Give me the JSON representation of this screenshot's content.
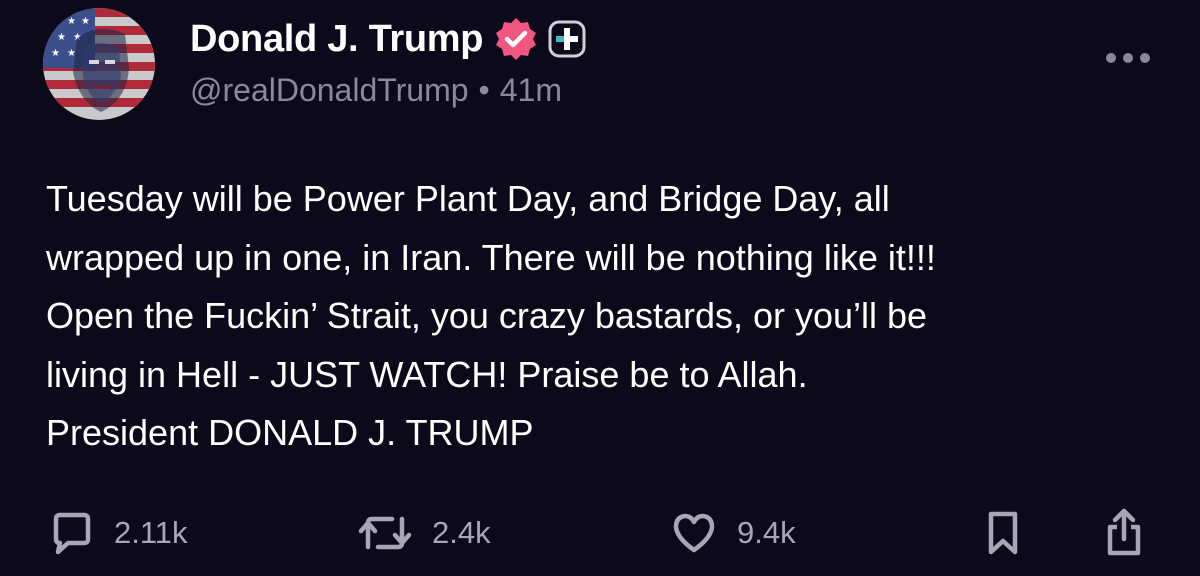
{
  "post": {
    "author": {
      "display_name": "Donald J. Trump",
      "handle": "@realDonaldTrump",
      "separator": "•",
      "time_ago": "41m",
      "avatar_icon": "flag-portrait-avatar",
      "verified_icon": "verified-badge-icon",
      "plus_icon": "plus-badge-icon"
    },
    "more_icon": "more-options-icon",
    "body_lines": [
      "Tuesday will be Power Plant Day, and Bridge Day, all",
      "wrapped up in one, in Iran. There will be nothing like it!!!",
      "Open the Fuckin’ Strait, you crazy bastards, or you’ll be",
      "living in Hell - JUST WATCH! Praise be to Allah.",
      "President DONALD J. TRUMP"
    ],
    "actions": {
      "reply": {
        "icon": "comment-icon",
        "count": "2.11k"
      },
      "repost": {
        "icon": "repost-icon",
        "count": "2.4k"
      },
      "like": {
        "icon": "heart-icon",
        "count": "9.4k"
      },
      "bookmark": {
        "icon": "bookmark-icon"
      },
      "share": {
        "icon": "share-icon"
      }
    }
  },
  "colors": {
    "background": "#0c0a1a",
    "text": "#ffffff",
    "secondary_text": "#8a8a96",
    "verified_badge": "#f2557f",
    "plus_badge": "#3fb8c4"
  }
}
